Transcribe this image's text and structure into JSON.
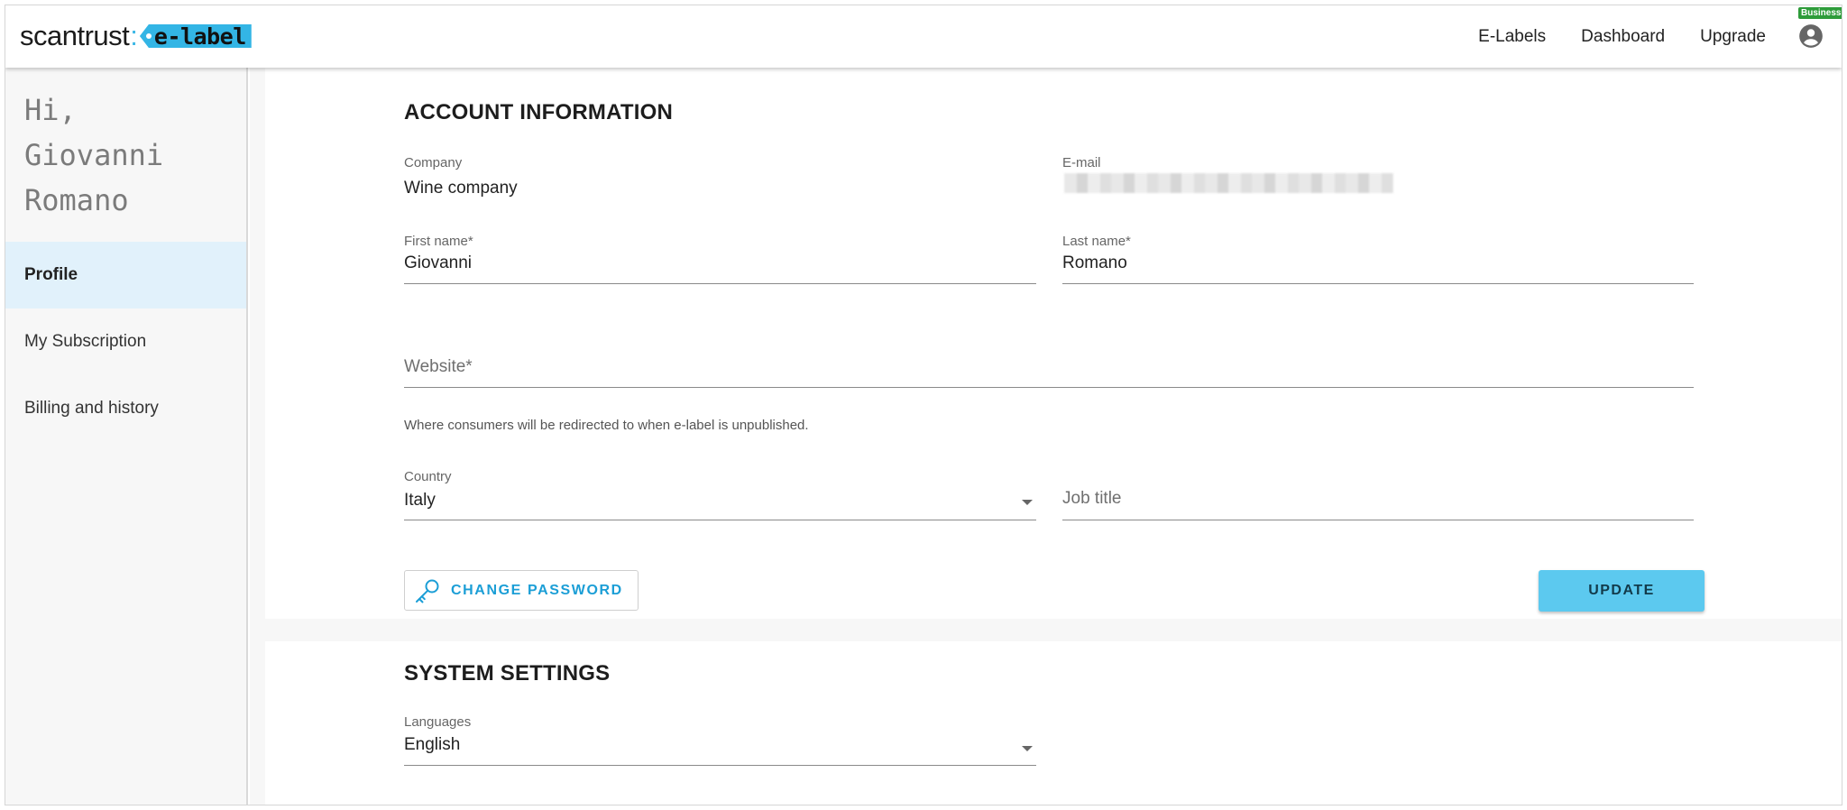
{
  "header": {
    "logo_main": "scantrust",
    "logo_colon": ":",
    "logo_tag": "e-label",
    "nav": [
      "E-Labels",
      "Dashboard",
      "Upgrade"
    ],
    "plan_badge": "Business",
    "account_icon": "account-circle-icon"
  },
  "sidebar": {
    "greeting": "Hi, Giovanni Romano",
    "items": [
      {
        "label": "Profile",
        "active": true
      },
      {
        "label": "My Subscription",
        "active": false
      },
      {
        "label": "Billing and history",
        "active": false
      }
    ]
  },
  "account": {
    "title": "ACCOUNT INFORMATION",
    "company_label": "Company",
    "company_value": "Wine company",
    "email_label": "E-mail",
    "first_name_label": "First name*",
    "first_name_value": "Giovanni",
    "last_name_label": "Last name*",
    "last_name_value": "Romano",
    "website_placeholder": "Website*",
    "website_helper": "Where consumers will be redirected to when e-label is unpublished.",
    "country_label": "Country",
    "country_value": "Italy",
    "job_title_placeholder": "Job title",
    "change_password_label": "CHANGE PASSWORD",
    "update_label": "UPDATE"
  },
  "system": {
    "title": "SYSTEM SETTINGS",
    "languages_label": "Languages",
    "languages_value": "English"
  },
  "colors": {
    "accent": "#33b5e5",
    "primary_button": "#5cc9ef",
    "link": "#1b9ed6",
    "badge": "#2e9c3a",
    "sidebar_active": "#e1f1fb"
  }
}
